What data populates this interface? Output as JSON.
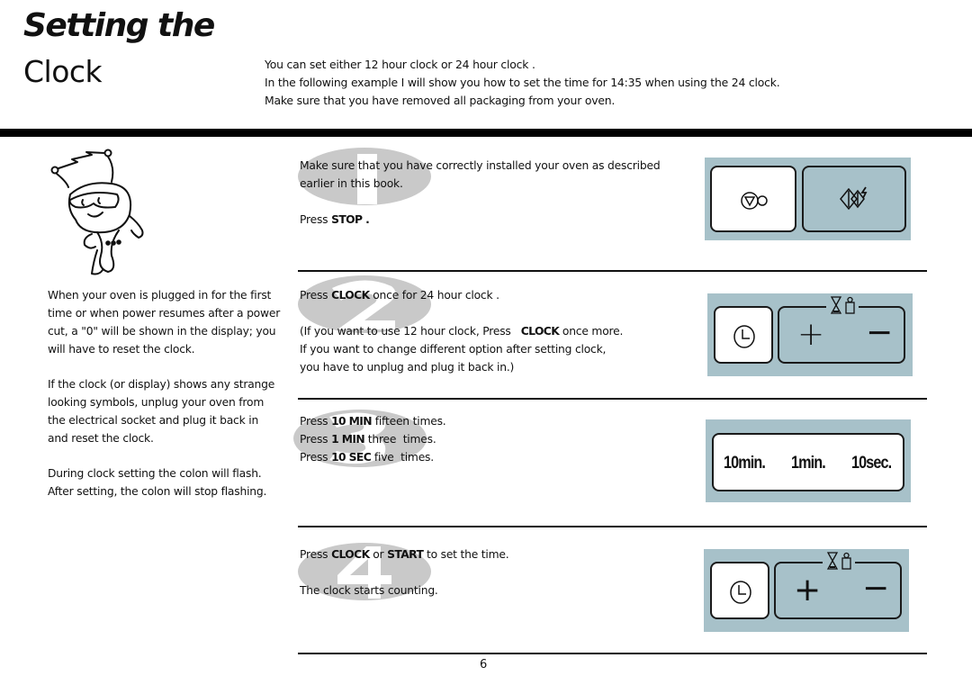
{
  "header": {
    "title_line1": "Setting the",
    "title_line2": "Clock",
    "intro": [
      "You can set either 12 hour clock or 24 hour clock .",
      "In the following example I will show you how to set the time for 14:35 when using the 24 clock.",
      "Make sure that you have removed all packaging from your oven."
    ]
  },
  "mascot": {
    "icon": "cartoon-character-icon"
  },
  "sidebar": {
    "paragraphs": [
      "When your oven is plugged in for the first time or when power resumes after a power cut, a \"0\" will be shown in the display; you will have to reset the clock.",
      "If the clock (or display) shows any strange looking symbols, unplug your oven from the electrical socket and plug it back in and reset the clock.",
      "During clock setting the colon will flash. After setting, the colon will stop flashing."
    ]
  },
  "steps": [
    {
      "number": "1",
      "lines": [
        {
          "pre": "Make sure that you have correctly installed your oven as described",
          "key": "",
          "post": ""
        },
        {
          "pre": "earlier in this book.",
          "key": "",
          "post": ""
        },
        {
          "pre": "",
          "key": "",
          "post": ""
        },
        {
          "pre": "Press ",
          "key": "STOP",
          "post": " ."
        }
      ],
      "panel": {
        "buttons": [
          "stop-icon",
          "eco-icon"
        ]
      }
    },
    {
      "number": "2",
      "lines": [
        {
          "pre": "Press ",
          "key": "CLOCK",
          "post": " once for 24 hour clock ."
        },
        {
          "pre": "",
          "key": "",
          "post": ""
        },
        {
          "pre": "(If you want to use 12 hour clock, Press   ",
          "key": "CLOCK",
          "post": " once more."
        },
        {
          "pre": "If you want to change different option after setting clock,",
          "key": "",
          "post": ""
        },
        {
          "pre": "you have to unplug and plug it back in.)",
          "key": "",
          "post": ""
        }
      ],
      "panel": {
        "clock_icon": "clock-icon",
        "plus": "+",
        "minus": "−",
        "top_icons": [
          "hourglass-icon",
          "weight-icon"
        ]
      }
    },
    {
      "number": "3",
      "lines": [
        {
          "pre": "Press ",
          "key": "10 MIN",
          "post": " fifteen times."
        },
        {
          "pre": "Press ",
          "key": "1 MIN",
          "post": " three  times."
        },
        {
          "pre": "Press ",
          "key": "10 SEC",
          "post": " five  times."
        }
      ],
      "panel": {
        "labels": [
          "10min.",
          "1min.",
          "10sec."
        ]
      }
    },
    {
      "number": "4",
      "lines": [
        {
          "pre": "Press ",
          "key": "CLOCK",
          "post": " or ",
          "key2": "START",
          "post2": " to set the time."
        },
        {
          "pre": "",
          "key": "",
          "post": ""
        },
        {
          "pre": "The clock starts counting.",
          "key": "",
          "post": ""
        }
      ],
      "panel": {
        "clock_icon": "clock-icon",
        "plus": "+",
        "minus": "−",
        "top_icons": [
          "hourglass-icon",
          "weight-icon"
        ]
      }
    }
  ],
  "footer": {
    "page_number": "6"
  },
  "colors": {
    "panel": "#a7c1c9",
    "badge": "#c9c9c9",
    "bar": "#000000"
  }
}
